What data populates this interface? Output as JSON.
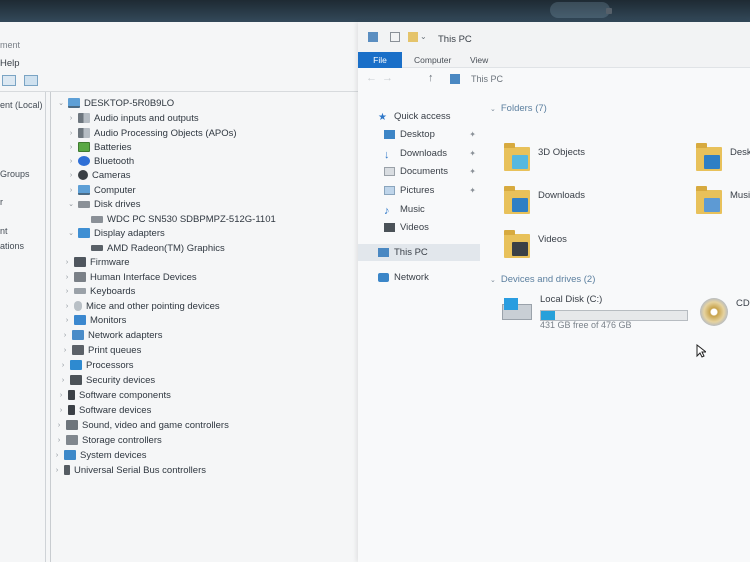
{
  "device_manager": {
    "menu_partial": "ment",
    "help_partial": "Help",
    "left_pane": [
      "ent (Local)",
      "Groups",
      "r",
      "nt",
      "ations"
    ],
    "root": "DESKTOP-5R0B9LO",
    "categories": [
      {
        "label": "Audio inputs and outputs",
        "icon": "speaker-icon",
        "expanded": false
      },
      {
        "label": "Audio Processing Objects (APOs)",
        "icon": "speaker-icon",
        "expanded": false
      },
      {
        "label": "Batteries",
        "icon": "battery-icon",
        "expanded": false
      },
      {
        "label": "Bluetooth",
        "icon": "bluetooth-icon",
        "expanded": false
      },
      {
        "label": "Cameras",
        "icon": "camera-icon",
        "expanded": false
      },
      {
        "label": "Computer",
        "icon": "computer-icon",
        "expanded": false
      },
      {
        "label": "Disk drives",
        "icon": "disk-drive-icon",
        "expanded": true,
        "children": [
          "WDC PC SN530 SDBPMPZ-512G-1101"
        ]
      },
      {
        "label": "Display adapters",
        "icon": "display-adapter-icon",
        "expanded": true,
        "children": [
          "AMD Radeon(TM) Graphics"
        ]
      },
      {
        "label": "Firmware",
        "icon": "firmware-icon",
        "expanded": false
      },
      {
        "label": "Human Interface Devices",
        "icon": "hid-icon",
        "expanded": false
      },
      {
        "label": "Keyboards",
        "icon": "keyboard-icon",
        "expanded": false
      },
      {
        "label": "Mice and other pointing devices",
        "icon": "mouse-icon",
        "expanded": false
      },
      {
        "label": "Monitors",
        "icon": "monitor-icon",
        "expanded": false
      },
      {
        "label": "Network adapters",
        "icon": "network-adapter-icon",
        "expanded": false
      },
      {
        "label": "Print queues",
        "icon": "printer-icon",
        "expanded": false
      },
      {
        "label": "Processors",
        "icon": "processor-icon",
        "expanded": false
      },
      {
        "label": "Security devices",
        "icon": "security-icon",
        "expanded": false
      },
      {
        "label": "Software components",
        "icon": "software-icon",
        "expanded": false
      },
      {
        "label": "Software devices",
        "icon": "software-icon",
        "expanded": false
      },
      {
        "label": "Sound, video and game controllers",
        "icon": "sound-icon",
        "expanded": false
      },
      {
        "label": "Storage controllers",
        "icon": "storage-icon",
        "expanded": false
      },
      {
        "label": "System devices",
        "icon": "system-icon",
        "expanded": false
      },
      {
        "label": "Universal Serial Bus controllers",
        "icon": "usb-icon",
        "expanded": false
      }
    ]
  },
  "explorer": {
    "title": "This PC",
    "tabs": [
      "File",
      "Computer",
      "View"
    ],
    "breadcrumb": "This PC",
    "nav": {
      "quick_access": "Quick access",
      "pinned": [
        "Desktop",
        "Downloads",
        "Documents",
        "Pictures"
      ],
      "unpinned": [
        "Music",
        "Videos"
      ],
      "this_pc": "This PC",
      "network": "Network"
    },
    "folders_header": "Folders (7)",
    "folders": [
      "3D Objects",
      "Deskt",
      "Downloads",
      "Musi",
      "Videos"
    ],
    "devices_header": "Devices and drives (2)",
    "drive": {
      "name": "Local Disk (C:)",
      "free_text": "431 GB free of 476 GB",
      "used_fraction": 0.094
    },
    "cd_partial": "CD"
  },
  "colors": {
    "accent": "#1a6fc8",
    "drive_fill": "#26a0da",
    "group_header": "#5b7f9f"
  }
}
